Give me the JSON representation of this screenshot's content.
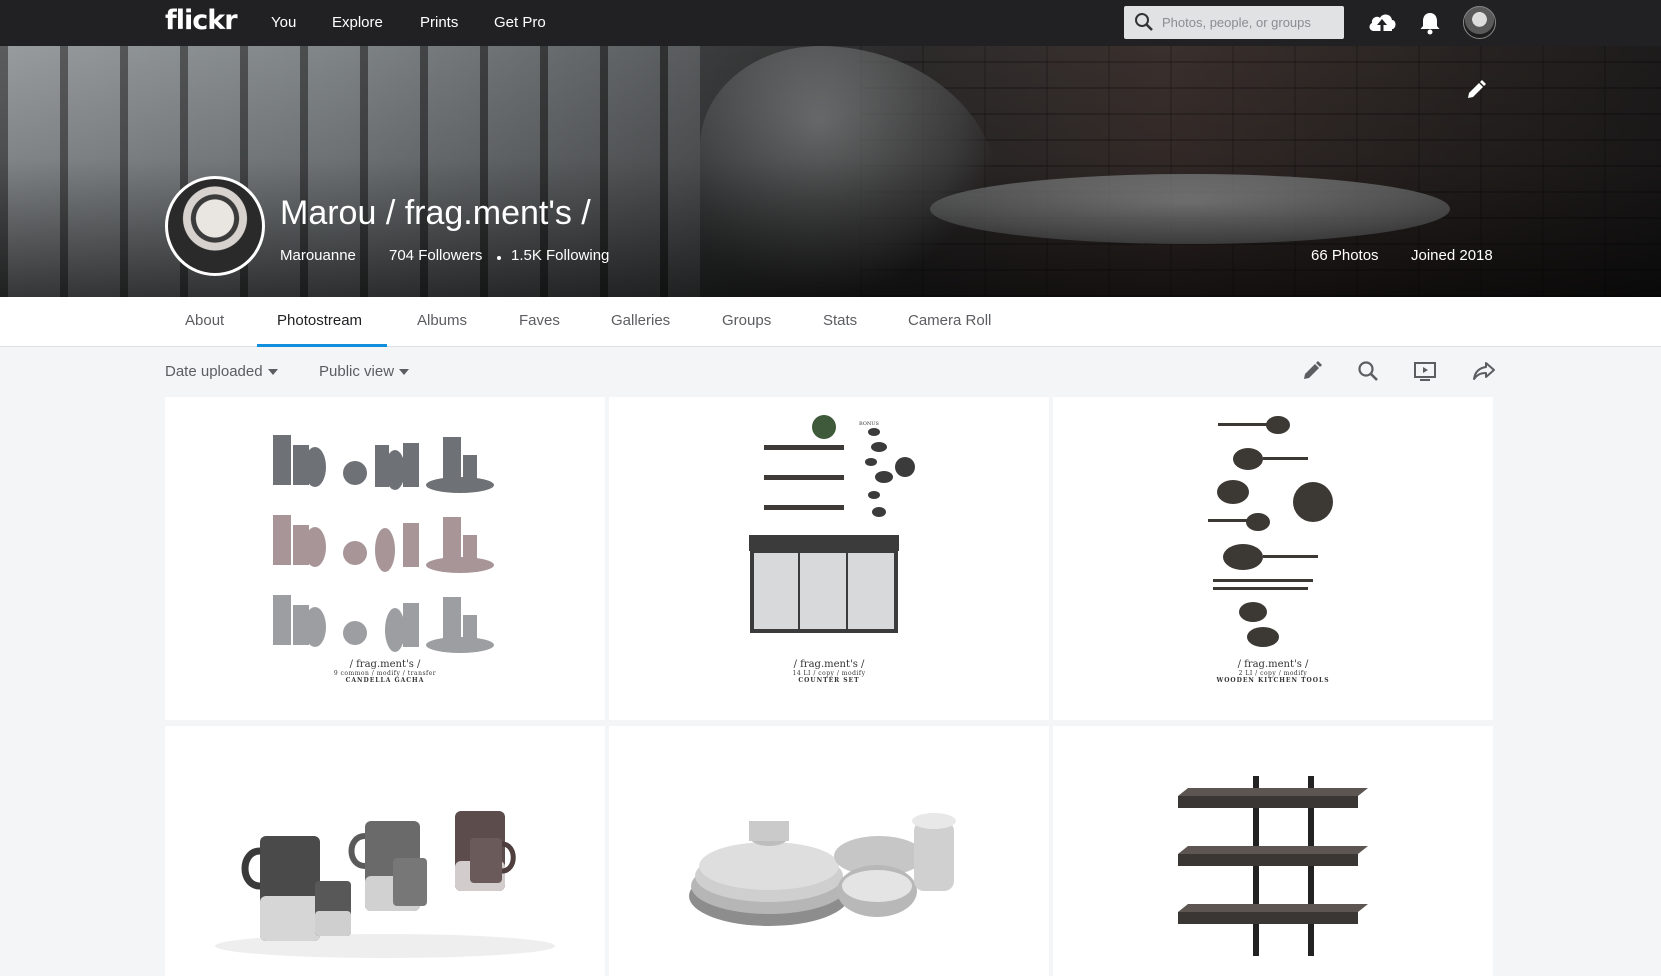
{
  "app": {
    "logo": "flickr"
  },
  "nav": {
    "links": [
      "You",
      "Explore",
      "Prints",
      "Get Pro"
    ]
  },
  "search": {
    "placeholder": "Photos, people, or groups"
  },
  "profile": {
    "name": "Marou / frag.ment's /",
    "username": "Marouanne",
    "followers": "704 Followers",
    "following": "1.5K Following",
    "photos": "66 Photos",
    "joined": "Joined 2018"
  },
  "tabs": [
    "About",
    "Photostream",
    "Albums",
    "Faves",
    "Galleries",
    "Groups",
    "Stats",
    "Camera Roll"
  ],
  "active_tab": "Photostream",
  "filters": {
    "sort": "Date uploaded",
    "view": "Public view"
  },
  "icons": {
    "search": "search-icon",
    "upload": "upload-cloud-icon",
    "notifications": "bell-icon",
    "edit_cover": "pencil-icon",
    "edit": "pencil-icon",
    "search_photos": "search-icon",
    "slideshow": "slideshow-icon",
    "share": "share-icon"
  },
  "colors": {
    "topbar": "#212124",
    "accent": "#128fdc",
    "page_bg": "#f3f5f6"
  },
  "photos": [
    {
      "title": "/ frag.ment's /",
      "subtitle": "9 common / modify / transfer",
      "label": "CANDELLA GACHA"
    },
    {
      "title": "/ frag.ment's /",
      "subtitle": "14 LI / copy / modify",
      "label": "COUNTER SET",
      "badge": "BONUS"
    },
    {
      "title": "/ frag.ment's /",
      "subtitle": "2 LI / copy / modify",
      "label": "WOODEN KITCHEN TOOLS"
    },
    {
      "title": "",
      "subtitle": "",
      "label": ""
    },
    {
      "title": "",
      "subtitle": "",
      "label": ""
    },
    {
      "title": "",
      "subtitle": "",
      "label": ""
    }
  ]
}
